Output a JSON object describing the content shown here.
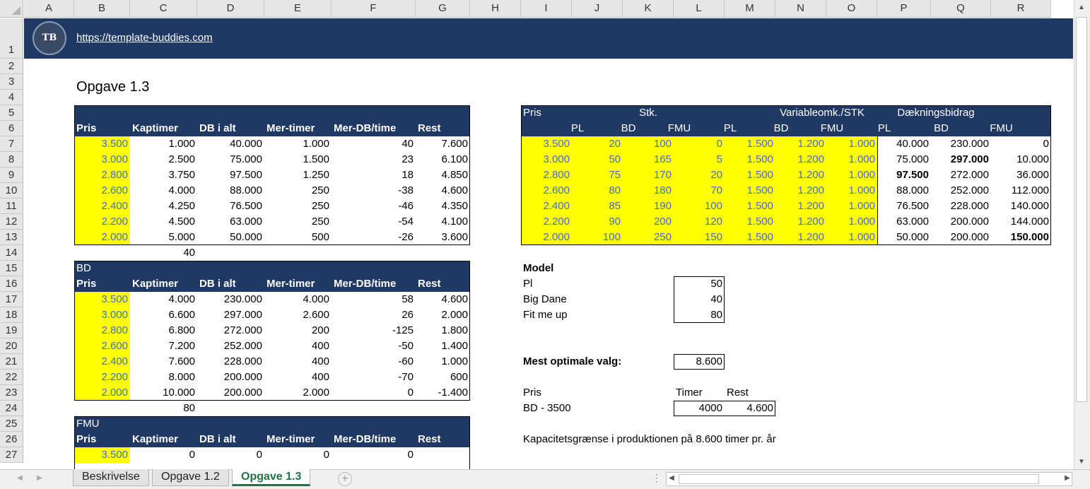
{
  "columns": [
    "A",
    "B",
    "C",
    "D",
    "E",
    "F",
    "G",
    "H",
    "I",
    "J",
    "K",
    "L",
    "M",
    "N",
    "O",
    "P",
    "Q",
    "R"
  ],
  "rows": [
    "1",
    "2",
    "3",
    "4",
    "5",
    "6",
    "7",
    "8",
    "9",
    "10",
    "11",
    "12",
    "13",
    "14",
    "15",
    "16",
    "17",
    "18",
    "19",
    "20",
    "21",
    "22",
    "23",
    "24",
    "25",
    "26",
    "27"
  ],
  "banner": {
    "url": "https://template-buddies.com",
    "logo_text": "TB"
  },
  "title": "Opgave 1.3",
  "pl_table": {
    "headers": [
      "Pris",
      "Kaptimer",
      "DB i alt",
      "Mer-timer",
      "Mer-DB/time",
      "Rest"
    ],
    "rows": [
      [
        "3.500",
        "1.000",
        "40.000",
        "1.000",
        "40",
        "7.600"
      ],
      [
        "3.000",
        "2.500",
        "75.000",
        "1.500",
        "23",
        "6.100"
      ],
      [
        "2.800",
        "3.750",
        "97.500",
        "1.250",
        "18",
        "4.850"
      ],
      [
        "2.600",
        "4.000",
        "88.000",
        "250",
        "-38",
        "4.600"
      ],
      [
        "2.400",
        "4.250",
        "76.500",
        "250",
        "-46",
        "4.350"
      ],
      [
        "2.200",
        "4.500",
        "63.000",
        "250",
        "-54",
        "4.100"
      ],
      [
        "2.000",
        "5.000",
        "50.000",
        "500",
        "-26",
        "3.600"
      ]
    ],
    "below": "40"
  },
  "bd_table": {
    "label": "BD",
    "headers": [
      "Pris",
      "Kaptimer",
      "DB i alt",
      "Mer-timer",
      "Mer-DB/time",
      "Rest"
    ],
    "rows": [
      [
        "3.500",
        "4.000",
        "230.000",
        "4.000",
        "58",
        "4.600"
      ],
      [
        "3.000",
        "6.600",
        "297.000",
        "2.600",
        "26",
        "2.000"
      ],
      [
        "2.800",
        "6.800",
        "272.000",
        "200",
        "-125",
        "1.800"
      ],
      [
        "2.600",
        "7.200",
        "252.000",
        "400",
        "-50",
        "1.400"
      ],
      [
        "2.400",
        "7.600",
        "228.000",
        "400",
        "-60",
        "1.000"
      ],
      [
        "2.200",
        "8.000",
        "200.000",
        "400",
        "-70",
        "600"
      ],
      [
        "2.000",
        "10.000",
        "200.000",
        "2.000",
        "0",
        "-1.400"
      ]
    ],
    "below": "80"
  },
  "fmu_table": {
    "label": "FMU",
    "headers": [
      "Pris",
      "Kaptimer",
      "DB i alt",
      "Mer-timer",
      "Mer-DB/time",
      "Rest"
    ],
    "rows": [
      [
        "3.500",
        "0",
        "0",
        "0",
        "0",
        ""
      ]
    ]
  },
  "right_table": {
    "group_headers": [
      "Pris",
      "Stk.",
      "Variableomk./STK",
      "Dækningsbidrag"
    ],
    "sub_headers": [
      "PL",
      "BD",
      "FMU",
      "PL",
      "BD",
      "FMU",
      "PL",
      "BD",
      "FMU"
    ],
    "rows": [
      [
        "3.500",
        "20",
        "100",
        "0",
        "1.500",
        "1.200",
        "1.000",
        "40.000",
        "230.000",
        "0"
      ],
      [
        "3.000",
        "50",
        "165",
        "5",
        "1.500",
        "1.200",
        "1.000",
        "75.000",
        "297.000",
        "10.000"
      ],
      [
        "2.800",
        "75",
        "170",
        "20",
        "1.500",
        "1.200",
        "1.000",
        "97.500",
        "272.000",
        "36.000"
      ],
      [
        "2.600",
        "80",
        "180",
        "70",
        "1.500",
        "1.200",
        "1.000",
        "88.000",
        "252.000",
        "112.000"
      ],
      [
        "2.400",
        "85",
        "190",
        "100",
        "1.500",
        "1.200",
        "1.000",
        "76.500",
        "228.000",
        "140.000"
      ],
      [
        "2.200",
        "90",
        "200",
        "120",
        "1.500",
        "1.200",
        "1.000",
        "63.000",
        "200.000",
        "144.000"
      ],
      [
        "2.000",
        "100",
        "250",
        "150",
        "1.500",
        "1.200",
        "1.000",
        "50.000",
        "200.000",
        "150.000"
      ]
    ]
  },
  "model": {
    "title": "Model",
    "items": [
      {
        "label": "Pl",
        "value": "50"
      },
      {
        "label": "Big Dane",
        "value": "40"
      },
      {
        "label": "Fit me up",
        "value": "80"
      }
    ],
    "optimal_label": "Mest optimale valg:",
    "optimal_value": "8.600",
    "pris_label": "Pris",
    "timer_label": "Timer",
    "rest_label": "Rest",
    "choice_label": "BD - 3500",
    "choice_timer": "4000",
    "choice_rest": "4.600",
    "note": "Kapacitetsgrænse i produktionen på 8.600 timer pr. år"
  },
  "tabs": [
    {
      "label": "Beskrivelse",
      "active": false
    },
    {
      "label": "Opgave 1.2",
      "active": false
    },
    {
      "label": "Opgave 1.3",
      "active": true
    }
  ],
  "colors": {
    "navy": "#1f3864",
    "highlight": "#ffff00",
    "input_blue": "#4472c4",
    "tab_green": "#217346"
  }
}
